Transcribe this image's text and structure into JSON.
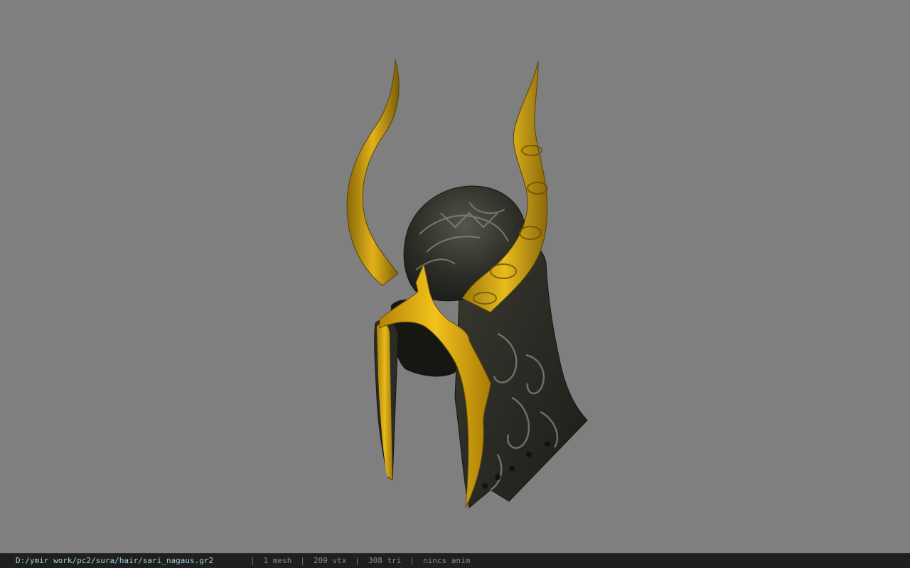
{
  "viewport": {
    "background": "#7f7f7f",
    "model": "horned helmet"
  },
  "status": {
    "file_path": "D:/ymir work/pc2/sura/hair/sari_nagaus.gr2",
    "separator": "|",
    "mesh_count": "1 mesh",
    "vertex_count": "209 vtx",
    "triangle_count": "308 tri",
    "anim_status": "nincs anim"
  },
  "colors": {
    "gold": "#d8a411",
    "dark_metal": "#2a2a24",
    "status_path": "#9fd0de",
    "status_text": "#8a8a8a"
  }
}
